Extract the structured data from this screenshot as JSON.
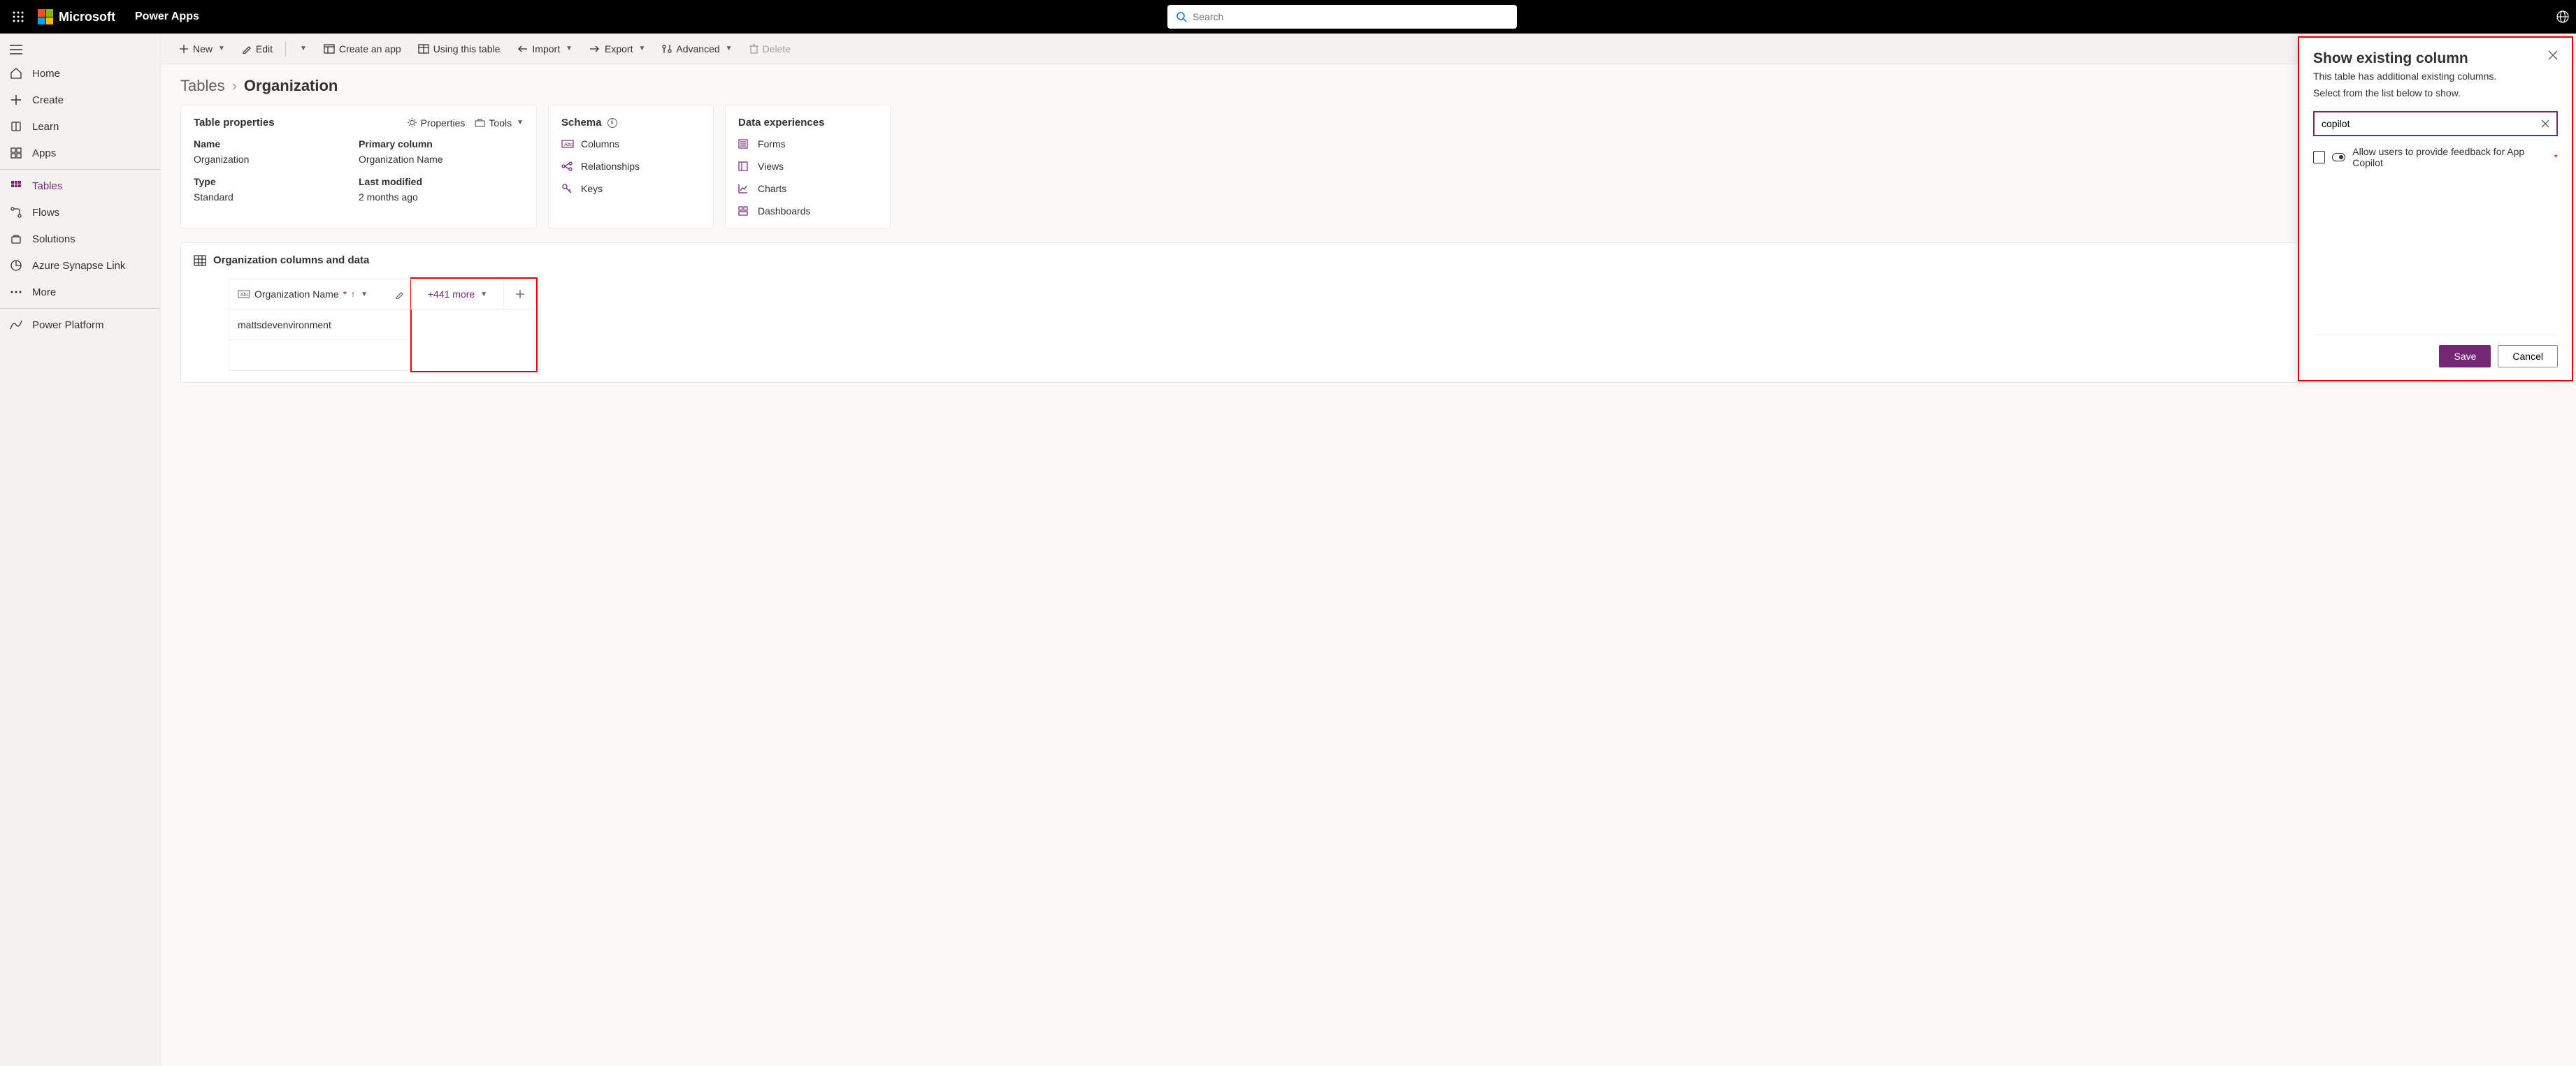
{
  "header": {
    "brand": "Microsoft",
    "app": "Power Apps",
    "search_placeholder": "Search"
  },
  "sidebar": {
    "items": [
      {
        "label": "Home",
        "icon": "home"
      },
      {
        "label": "Create",
        "icon": "plus"
      },
      {
        "label": "Learn",
        "icon": "book"
      },
      {
        "label": "Apps",
        "icon": "apps"
      },
      {
        "label": "Tables",
        "icon": "grid",
        "active": true
      },
      {
        "label": "Flows",
        "icon": "flow"
      },
      {
        "label": "Solutions",
        "icon": "solution"
      },
      {
        "label": "Azure Synapse Link",
        "icon": "pie"
      },
      {
        "label": "More",
        "icon": "more"
      },
      {
        "label": "Power Platform",
        "icon": "pp"
      }
    ]
  },
  "commandBar": {
    "new": "New",
    "edit": "Edit",
    "createApp": "Create an app",
    "usingTable": "Using this table",
    "import": "Import",
    "export": "Export",
    "advanced": "Advanced",
    "delete": "Delete"
  },
  "breadcrumb": {
    "root": "Tables",
    "current": "Organization"
  },
  "propsCard": {
    "title": "Table properties",
    "propertiesAction": "Properties",
    "toolsAction": "Tools",
    "nameLabel": "Name",
    "nameValue": "Organization",
    "primaryLabel": "Primary column",
    "primaryValue": "Organization Name",
    "typeLabel": "Type",
    "typeValue": "Standard",
    "lastModLabel": "Last modified",
    "lastModValue": "2 months ago"
  },
  "schemaCard": {
    "title": "Schema",
    "items": [
      "Columns",
      "Relationships",
      "Keys"
    ]
  },
  "dataCard": {
    "title": "Data experiences",
    "items": [
      "Forms",
      "Views",
      "Charts",
      "Dashboards"
    ]
  },
  "dataSection": {
    "title": "Organization columns and data",
    "colHeader": "Organization Name",
    "moreText": "+441 more",
    "row1": "mattsdevenvironment"
  },
  "panel": {
    "title": "Show existing column",
    "desc1": "This table has additional existing columns.",
    "desc2": "Select from the list below to show.",
    "searchValue": "copilot",
    "option": "Allow users to provide feedback for App Copilot",
    "save": "Save",
    "cancel": "Cancel"
  }
}
